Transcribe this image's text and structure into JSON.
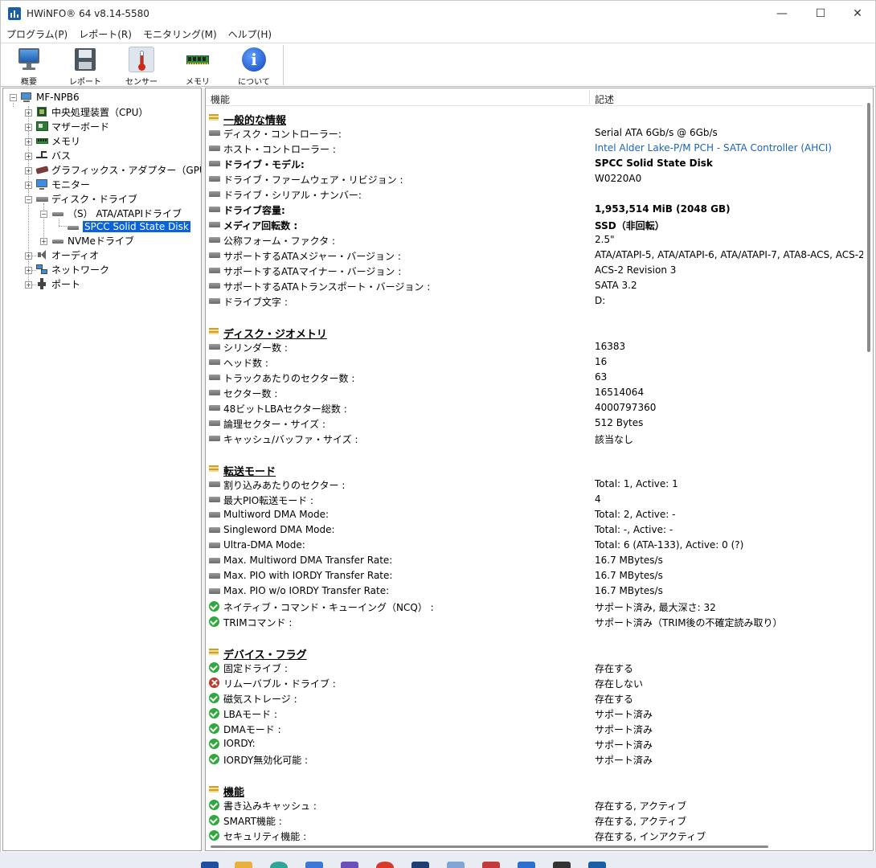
{
  "window": {
    "title": "HWiNFO® 64 v8.14-5580",
    "controls": [
      "—",
      "☐",
      "✕"
    ]
  },
  "menu": [
    "プログラム(P)",
    "レポート(R)",
    "モニタリング(M)",
    "ヘルプ(H)"
  ],
  "toolbar": [
    {
      "label": "概要",
      "icon": "monitor-icon"
    },
    {
      "label": "レポート",
      "icon": "floppy-disk-icon"
    },
    {
      "label": "センサー",
      "icon": "thermometer-icon"
    },
    {
      "label": "メモリ",
      "icon": "memory-module-icon"
    },
    {
      "label": "について",
      "icon": "info-icon"
    }
  ],
  "tree": {
    "root": "MF-NPB6",
    "items": [
      {
        "label": "中央処理装置（CPU）",
        "icon": "cpu-icon"
      },
      {
        "label": "マザーボード",
        "icon": "motherboard-icon"
      },
      {
        "label": "メモリ",
        "icon": "memory-icon"
      },
      {
        "label": "バス",
        "icon": "bus-icon"
      },
      {
        "label": "グラフィックス・アダプター（GPU）",
        "icon": "gpu-icon"
      },
      {
        "label": "モニター",
        "icon": "monitor-icon"
      },
      {
        "label": "ディスク・ドライブ",
        "icon": "disk-icon"
      },
      {
        "label": "（S） ATA/ATAPIドライブ",
        "icon": "drive-icon"
      },
      {
        "label": "SPCC Solid State Disk",
        "icon": "drive-icon"
      },
      {
        "label": "NVMeドライブ",
        "icon": "drive-icon"
      },
      {
        "label": "オーディオ",
        "icon": "speaker-icon"
      },
      {
        "label": "ネットワーク",
        "icon": "network-icon"
      },
      {
        "label": "ポート",
        "icon": "port-icon"
      }
    ]
  },
  "details": {
    "col_feature": "機能",
    "col_desc": "記述",
    "rows": [
      {
        "t": "sec",
        "k": "一般的な情報"
      },
      {
        "t": "drv",
        "k": "ディスク・コントローラー:",
        "v": "Serial ATA 6Gb/s @ 6Gb/s"
      },
      {
        "t": "drv",
        "k": "ホスト・コントローラー :",
        "v": "Intel Alder Lake-P/M PCH - SATA Controller (AHCI)",
        "link": true
      },
      {
        "t": "drv",
        "k": "ドライブ・モデル:",
        "v": "SPCC Solid State Disk",
        "bold": true
      },
      {
        "t": "drv",
        "k": "ドライブ・ファームウェア・リビジョン :",
        "v": "W0220A0"
      },
      {
        "t": "drv",
        "k": "ドライブ・シリアル・ナンバー:",
        "v": ""
      },
      {
        "t": "drv",
        "k": "ドライブ容量:",
        "v": "1,953,514 MiB (2048 GB)",
        "bold": true
      },
      {
        "t": "drv",
        "k": "メディア回転数 :",
        "v": "SSD（非回転）",
        "bold": true
      },
      {
        "t": "drv",
        "k": "公称フォーム・ファクタ :",
        "v": "2.5\""
      },
      {
        "t": "drv",
        "k": "サポートするATAメジャー・バージョン :",
        "v": "ATA/ATAPI-5, ATA/ATAPI-6, ATA/ATAPI-7, ATA8-ACS, ACS-2"
      },
      {
        "t": "drv",
        "k": "サポートするATAマイナー・バージョン :",
        "v": "ACS-2 Revision 3"
      },
      {
        "t": "drv",
        "k": "サポートするATAトランスポート・バージョン :",
        "v": "SATA 3.2"
      },
      {
        "t": "drv",
        "k": "ドライブ文字 :",
        "v": "D:"
      },
      {
        "t": "gap"
      },
      {
        "t": "sec",
        "k": "ディスク・ジオメトリ"
      },
      {
        "t": "drv",
        "k": "シリンダー数 :",
        "v": "16383"
      },
      {
        "t": "drv",
        "k": "ヘッド数 :",
        "v": "16"
      },
      {
        "t": "drv",
        "k": "トラックあたりのセクター数 :",
        "v": "63"
      },
      {
        "t": "drv",
        "k": "セクター数 :",
        "v": "16514064"
      },
      {
        "t": "drv",
        "k": "48ビットLBAセクター総数 :",
        "v": "4000797360"
      },
      {
        "t": "drv",
        "k": "論理セクター・サイズ :",
        "v": "512 Bytes"
      },
      {
        "t": "drv",
        "k": "キャッシュ/バッファ・サイズ :",
        "v": "該当なし"
      },
      {
        "t": "gap"
      },
      {
        "t": "sec",
        "k": "転送モード"
      },
      {
        "t": "drv",
        "k": "割り込みあたりのセクター :",
        "v": "Total: 1, Active: 1"
      },
      {
        "t": "drv",
        "k": "最大PIO転送モード :",
        "v": "4"
      },
      {
        "t": "drv",
        "k": "Multiword DMA Mode:",
        "v": "Total: 2, Active: -"
      },
      {
        "t": "drv",
        "k": "Singleword DMA Mode:",
        "v": "Total: -, Active: -"
      },
      {
        "t": "drv",
        "k": "Ultra-DMA Mode:",
        "v": "Total: 6 (ATA-133), Active: 0 (?)"
      },
      {
        "t": "drv",
        "k": "Max. Multiword DMA Transfer Rate:",
        "v": "16.7 MBytes/s"
      },
      {
        "t": "drv",
        "k": "Max. PIO with IORDY Transfer Rate:",
        "v": "16.7 MBytes/s"
      },
      {
        "t": "drv",
        "k": "Max. PIO w/o IORDY Transfer Rate:",
        "v": "16.7 MBytes/s"
      },
      {
        "t": "ok",
        "k": "ネイティブ・コマンド・キューイング（NCQ） :",
        "v": "サポート済み, 最大深さ: 32"
      },
      {
        "t": "ok",
        "k": "TRIMコマンド :",
        "v": "サポート済み（TRIM後の不確定読み取り）"
      },
      {
        "t": "gap"
      },
      {
        "t": "sec",
        "k": "デバイス・フラグ"
      },
      {
        "t": "ok",
        "k": "固定ドライブ :",
        "v": "存在する"
      },
      {
        "t": "ng",
        "k": "リムーバブル・ドライブ :",
        "v": "存在しない"
      },
      {
        "t": "ok",
        "k": "磁気ストレージ :",
        "v": "存在する"
      },
      {
        "t": "ok",
        "k": "LBAモード :",
        "v": "サポート済み"
      },
      {
        "t": "ok",
        "k": "DMAモード :",
        "v": "サポート済み"
      },
      {
        "t": "ok",
        "k": "IORDY:",
        "v": "サポート済み"
      },
      {
        "t": "ok",
        "k": "IORDY無効化可能 :",
        "v": "サポート済み"
      },
      {
        "t": "gap"
      },
      {
        "t": "sec",
        "k": "機能"
      },
      {
        "t": "ok",
        "k": "書き込みキャッシュ :",
        "v": "存在する, アクティブ"
      },
      {
        "t": "ok",
        "k": "SMART機能 :",
        "v": "存在する, アクティブ"
      },
      {
        "t": "ok",
        "k": "セキュリティ機能 :",
        "v": "存在する, インアクティブ"
      }
    ]
  }
}
